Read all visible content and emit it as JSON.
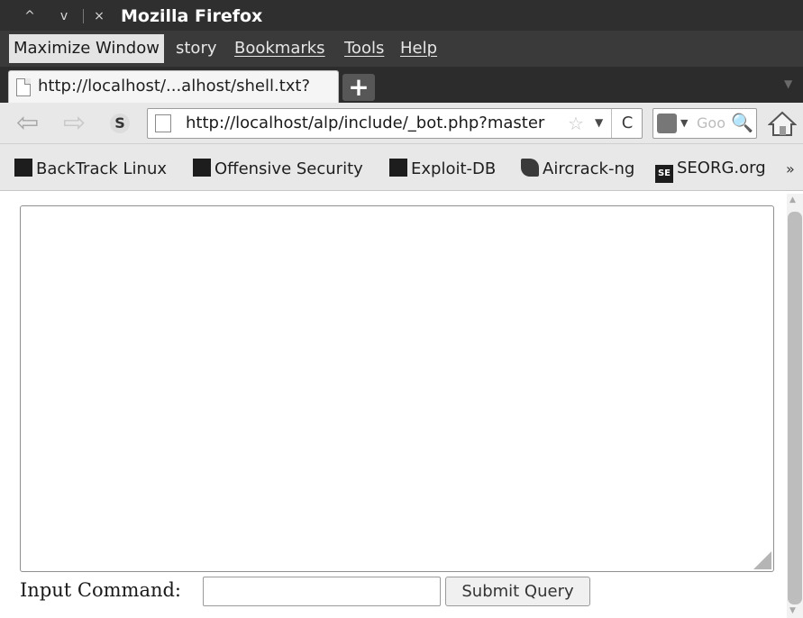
{
  "window": {
    "title": "Mozilla Firefox",
    "controls": {
      "minimize": "^",
      "maximize": "v",
      "close": "×"
    }
  },
  "menubar": {
    "tooltip": "Maximize Window",
    "items": [
      {
        "label": "story"
      },
      {
        "label": "Bookmarks"
      },
      {
        "label": "Tools"
      },
      {
        "label": "Help"
      }
    ]
  },
  "tabs": {
    "active_label": "http://localhost/...alhost/shell.txt?",
    "new_tab": "+",
    "list_arrow": "▼"
  },
  "navbar": {
    "back": "⇦",
    "forward": "⇨",
    "sync": "S",
    "url": "http://localhost/alp/include/_bot.php?master",
    "star": "☆",
    "url_dropdown": "▼",
    "reload": "C",
    "search_placeholder": "Goo",
    "search_dropdown": "▼",
    "search_button": "🔍"
  },
  "bookmarks": {
    "items": [
      {
        "label": "BackTrack Linux",
        "icon": "backtrack-icon"
      },
      {
        "label": "Offensive Security",
        "icon": "offensive-security-icon"
      },
      {
        "label": "Exploit-DB",
        "icon": "exploit-db-icon"
      },
      {
        "label": "Aircrack-ng",
        "icon": "aircrack-icon"
      },
      {
        "label": "SEORG.org",
        "icon": "seorg-icon",
        "icon_text": "SE"
      }
    ],
    "overflow": "»"
  },
  "page": {
    "output_value": "",
    "input_label": "Input Command:",
    "input_value": "",
    "submit_label": "Submit Query"
  }
}
